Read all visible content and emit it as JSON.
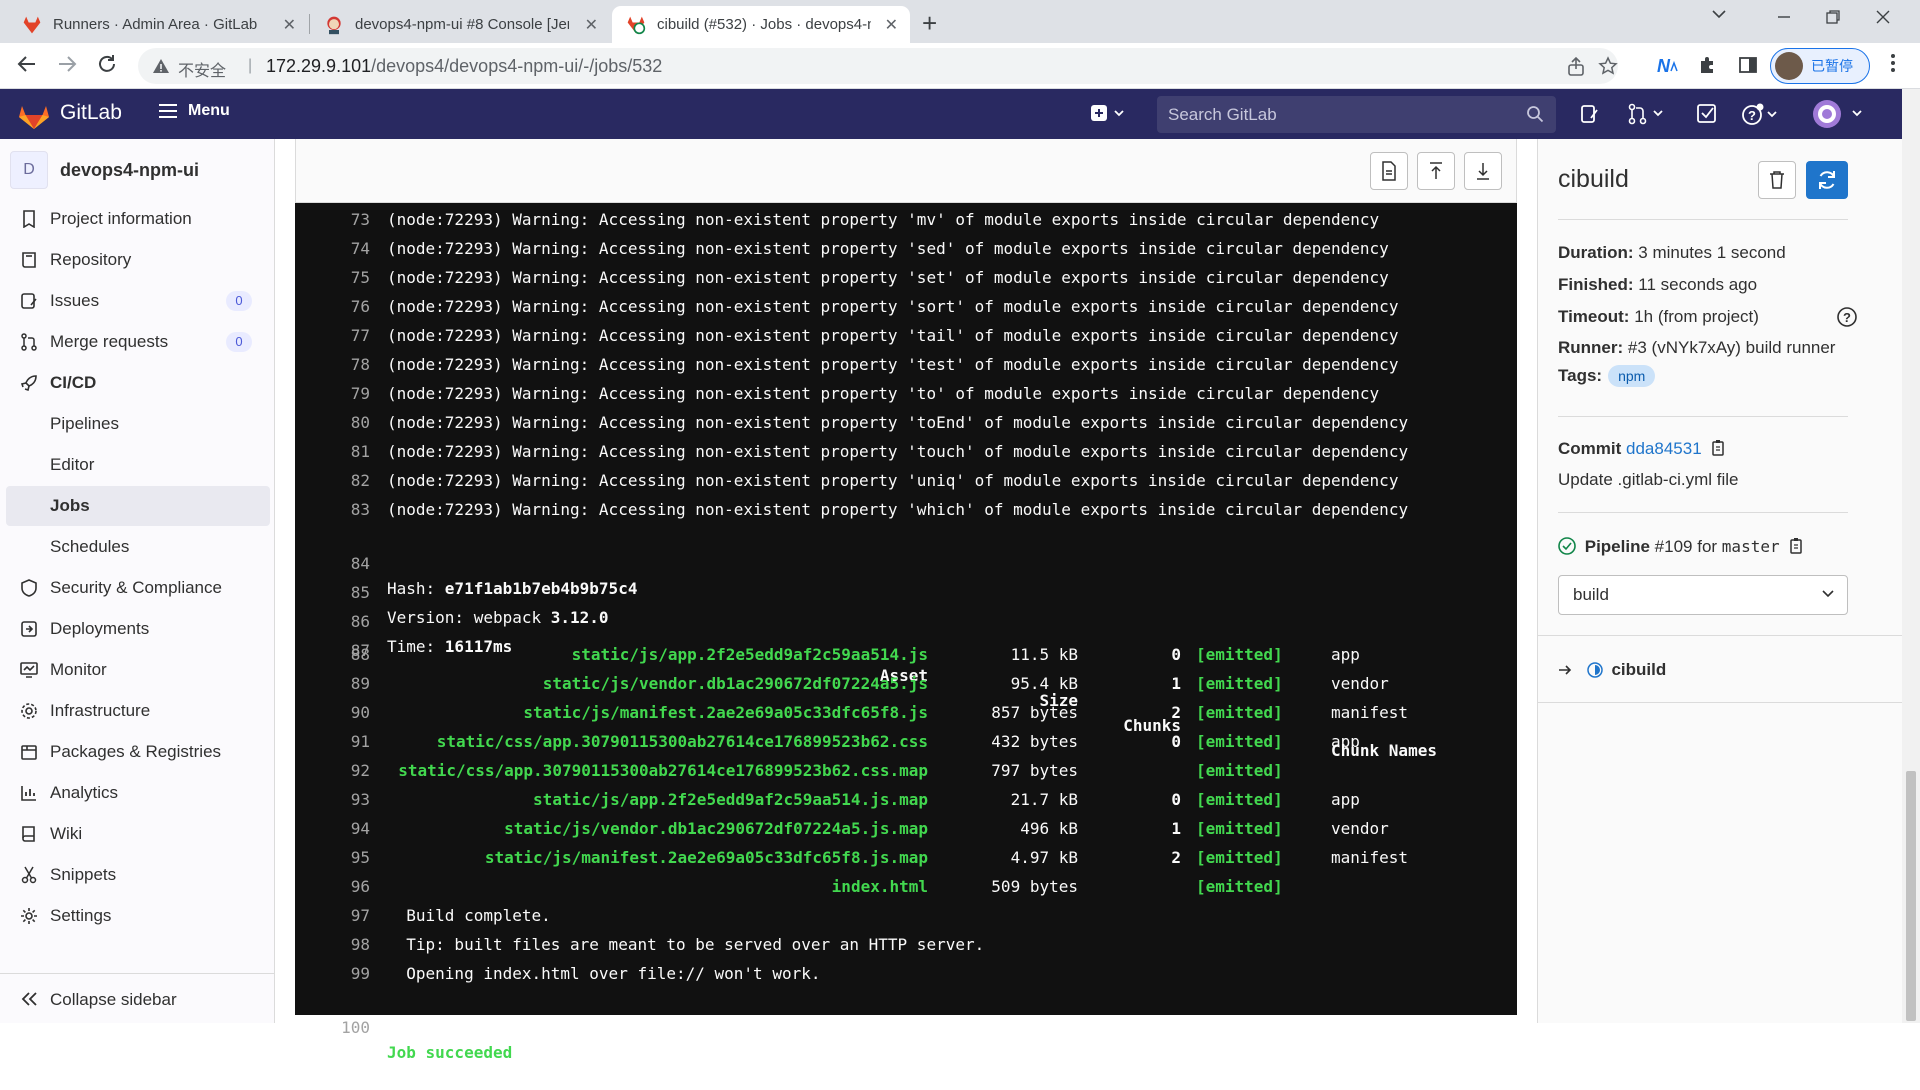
{
  "browser": {
    "tabs": [
      {
        "title": "Runners · Admin Area · GitLab",
        "icon": "gitlab-fox-icon"
      },
      {
        "title": "devops4-npm-ui #8 Console [Jenkins]",
        "icon": "jenkins-icon"
      },
      {
        "title": "cibuild (#532) · Jobs · devops4-npm-ui",
        "icon": "job-success-icon"
      }
    ],
    "insecure_label": "不安全",
    "url_host": "172.29.9.101",
    "url_path": "/devops4/devops4-npm-ui/-/jobs/532",
    "profile_label": "已暂停"
  },
  "gitlab_header": {
    "brand": "GitLab",
    "menu_label": "Menu",
    "search_placeholder": "Search GitLab"
  },
  "sidebar": {
    "project_initial": "D",
    "project_name": "devops4-npm-ui",
    "items": [
      {
        "label": "Project information",
        "icon": "info-icon"
      },
      {
        "label": "Repository",
        "icon": "repository-icon"
      },
      {
        "label": "Issues",
        "icon": "issues-icon",
        "badge": "0"
      },
      {
        "label": "Merge requests",
        "icon": "merge-request-icon",
        "badge": "0"
      },
      {
        "label": "CI/CD",
        "icon": "rocket-icon"
      },
      {
        "label": "Pipelines"
      },
      {
        "label": "Editor"
      },
      {
        "label": "Jobs"
      },
      {
        "label": "Schedules"
      },
      {
        "label": "Security & Compliance",
        "icon": "shield-icon"
      },
      {
        "label": "Deployments",
        "icon": "deployments-icon"
      },
      {
        "label": "Monitor",
        "icon": "monitor-icon"
      },
      {
        "label": "Infrastructure",
        "icon": "cloud-gear-icon"
      },
      {
        "label": "Packages & Registries",
        "icon": "package-icon"
      },
      {
        "label": "Analytics",
        "icon": "chart-icon"
      },
      {
        "label": "Wiki",
        "icon": "book-icon"
      },
      {
        "label": "Snippets",
        "icon": "scissors-icon"
      },
      {
        "label": "Settings",
        "icon": "gear-icon"
      }
    ],
    "collapse_label": "Collapse sidebar"
  },
  "log": {
    "lines": [
      {
        "n": "73",
        "t": "(node:72293) Warning: Accessing non-existent property 'mv' of module exports inside circular dependency"
      },
      {
        "n": "74",
        "t": "(node:72293) Warning: Accessing non-existent property 'sed' of module exports inside circular dependency"
      },
      {
        "n": "75",
        "t": "(node:72293) Warning: Accessing non-existent property 'set' of module exports inside circular dependency"
      },
      {
        "n": "76",
        "t": "(node:72293) Warning: Accessing non-existent property 'sort' of module exports inside circular dependency"
      },
      {
        "n": "77",
        "t": "(node:72293) Warning: Accessing non-existent property 'tail' of module exports inside circular dependency"
      },
      {
        "n": "78",
        "t": "(node:72293) Warning: Accessing non-existent property 'test' of module exports inside circular dependency"
      },
      {
        "n": "79",
        "t": "(node:72293) Warning: Accessing non-existent property 'to' of module exports inside circular dependency"
      },
      {
        "n": "80",
        "t": "(node:72293) Warning: Accessing non-existent property 'toEnd' of module exports inside circular dependency"
      },
      {
        "n": "81",
        "t": "(node:72293) Warning: Accessing non-existent property 'touch' of module exports inside circular dependency"
      },
      {
        "n": "82",
        "t": "(node:72293) Warning: Accessing non-existent property 'uniq' of module exports inside circular dependency"
      },
      {
        "n": "83",
        "t": "(node:72293) Warning: Accessing non-existent property 'which' of module exports inside circular dependency"
      }
    ],
    "hash": {
      "n": "84",
      "label": "Hash: ",
      "value": "e71f1ab1b7eb4b9b75c4"
    },
    "version": {
      "n": "85",
      "label": "Version: webpack ",
      "value": "3.12.0"
    },
    "time": {
      "n": "86",
      "label": "Time: ",
      "value": "16117ms"
    },
    "table_header": {
      "n": "87",
      "asset": "Asset",
      "size": "Size",
      "chunks": "Chunks",
      "names": "Chunk Names"
    },
    "assets": [
      {
        "n": "88",
        "asset": "static/js/app.2f2e5edd9af2c59aa514.js",
        "size": "11.5 kB",
        "chunks": "0",
        "emitted": "[emitted]",
        "name": "app"
      },
      {
        "n": "89",
        "asset": "static/js/vendor.db1ac290672df07224a5.js",
        "size": "95.4 kB",
        "chunks": "1",
        "emitted": "[emitted]",
        "name": "vendor"
      },
      {
        "n": "90",
        "asset": "static/js/manifest.2ae2e69a05c33dfc65f8.js",
        "size": "857 bytes",
        "chunks": "2",
        "emitted": "[emitted]",
        "name": "manifest"
      },
      {
        "n": "91",
        "asset": "static/css/app.30790115300ab27614ce176899523b62.css",
        "size": "432 bytes",
        "chunks": "0",
        "emitted": "[emitted]",
        "name": "app"
      },
      {
        "n": "92",
        "asset": "static/css/app.30790115300ab27614ce176899523b62.css.map",
        "size": "797 bytes",
        "chunks": "",
        "emitted": "[emitted]",
        "name": ""
      },
      {
        "n": "93",
        "asset": "static/js/app.2f2e5edd9af2c59aa514.js.map",
        "size": "21.7 kB",
        "chunks": "0",
        "emitted": "[emitted]",
        "name": "app"
      },
      {
        "n": "94",
        "asset": "static/js/vendor.db1ac290672df07224a5.js.map",
        "size": "496 kB",
        "chunks": "1",
        "emitted": "[emitted]",
        "name": "vendor"
      },
      {
        "n": "95",
        "asset": "static/js/manifest.2ae2e69a05c33dfc65f8.js.map",
        "size": "4.97 kB",
        "chunks": "2",
        "emitted": "[emitted]",
        "name": "manifest"
      },
      {
        "n": "96",
        "asset": "index.html",
        "size": "509 bytes",
        "chunks": "",
        "emitted": "[emitted]",
        "name": ""
      }
    ],
    "tail": [
      {
        "n": "97",
        "t": "  Build complete."
      },
      {
        "n": "98",
        "t": "  Tip: built files are meant to be served over an HTTP server."
      },
      {
        "n": "99",
        "t": "  Opening index.html over file:// won't work."
      }
    ],
    "result": {
      "n": "100",
      "t": "Job succeeded"
    }
  },
  "job_sidebar": {
    "job_name": "cibuild",
    "duration_label": "Duration:",
    "duration": "3 minutes 1 second",
    "finished_label": "Finished:",
    "finished": "11 seconds ago",
    "timeout_label": "Timeout:",
    "timeout": "1h (from project)",
    "runner_label": "Runner:",
    "runner": "#3 (vNYk7xAy) build runner",
    "tags_label": "Tags:",
    "tag": "npm",
    "commit_label": "Commit",
    "commit_sha": "dda84531",
    "commit_message": "Update .gitlab-ci.yml file",
    "pipeline_label": "Pipeline",
    "pipeline_id": "#109",
    "pipeline_for": "for",
    "pipeline_ref": "master",
    "stage": "build",
    "current_job": "cibuild"
  }
}
